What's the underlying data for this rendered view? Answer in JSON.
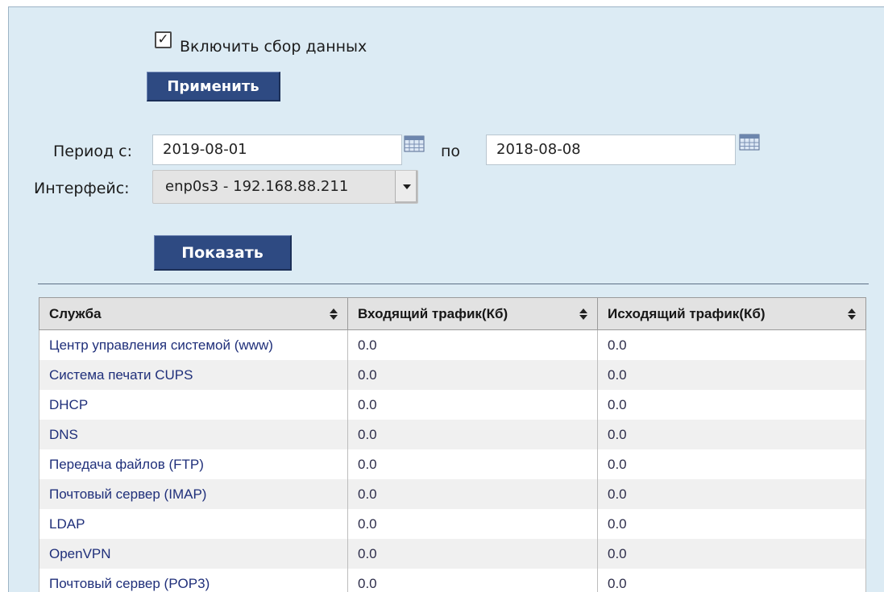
{
  "collect": {
    "checked": true,
    "label": "Включить сбор данных"
  },
  "apply_button": "Применить",
  "period": {
    "from_label": "Период с:",
    "from_value": "2019-08-01",
    "to_label": "по",
    "to_value": "2018-08-08"
  },
  "interface": {
    "label": "Интерфейс:",
    "selected": "enp0s3 - 192.168.88.211"
  },
  "show_button": "Показать",
  "table": {
    "headers": [
      "Служба",
      "Входящий трафик(Кб)",
      "Исходящий трафик(Кб)"
    ],
    "rows": [
      [
        "Центр управления системой (www)",
        "0.0",
        "0.0"
      ],
      [
        "Система печати CUPS",
        "0.0",
        "0.0"
      ],
      [
        "DHCP",
        "0.0",
        "0.0"
      ],
      [
        "DNS",
        "0.0",
        "0.0"
      ],
      [
        "Передача файлов (FTP)",
        "0.0",
        "0.0"
      ],
      [
        "Почтовый сервер (IMAP)",
        "0.0",
        "0.0"
      ],
      [
        "LDAP",
        "0.0",
        "0.0"
      ],
      [
        "OpenVPN",
        "0.0",
        "0.0"
      ],
      [
        "Почтовый сервер (POP3)",
        "0.0",
        "0.0"
      ]
    ]
  },
  "colors": {
    "panel": "#dcebf4",
    "button": "#2e4a82",
    "link": "#1f2f7a"
  },
  "icons": [
    "checkbox-check-icon",
    "calendar-icon",
    "dropdown-arrow-icon",
    "sort-icon"
  ]
}
